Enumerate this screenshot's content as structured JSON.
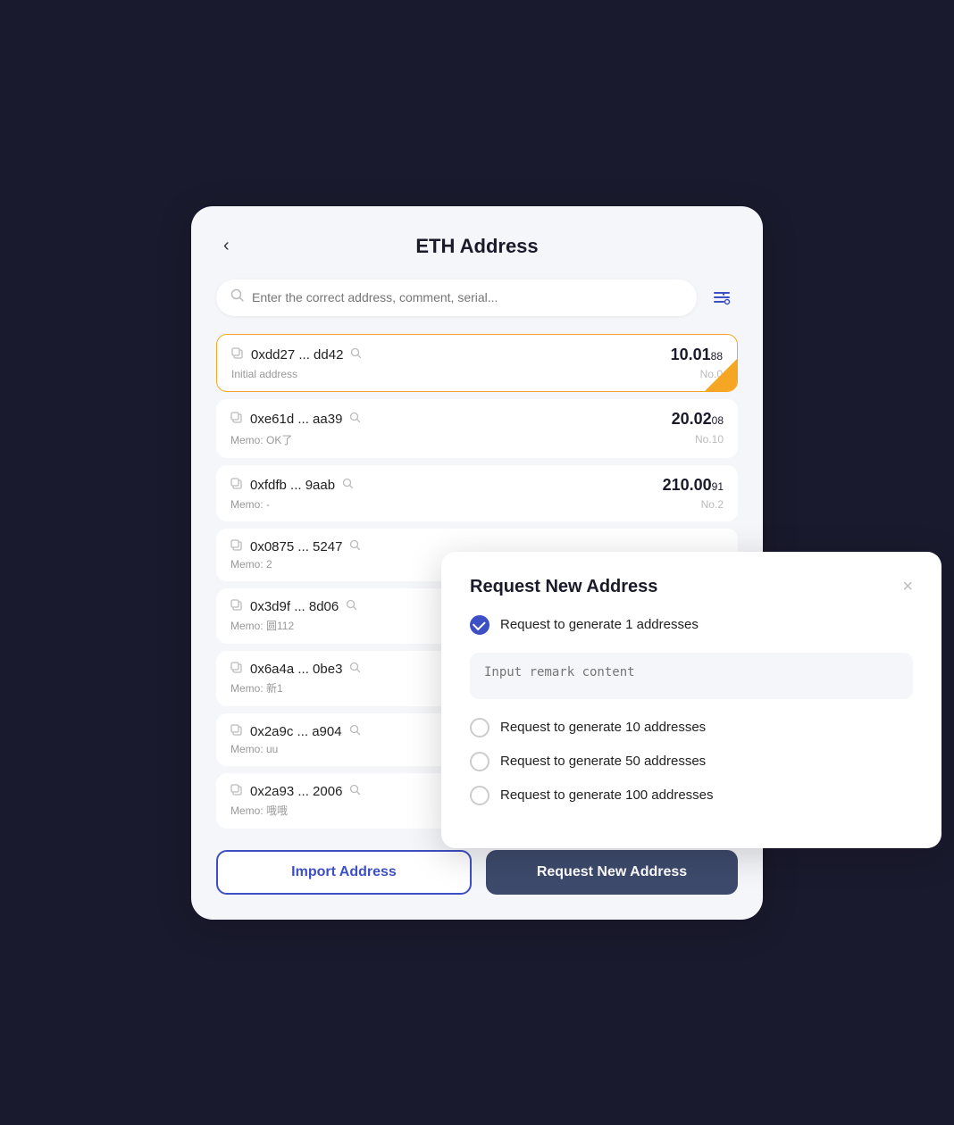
{
  "page": {
    "title": "ETH Address",
    "back_label": "‹"
  },
  "search": {
    "placeholder": "Enter the correct address, comment, serial..."
  },
  "addresses": [
    {
      "hash": "0xdd27 ... dd42",
      "memo": "Initial address",
      "balance_main": "10.01",
      "balance_decimal": "88",
      "no": "No.0",
      "selected": true
    },
    {
      "hash": "0xe61d ... aa39",
      "memo": "Memo: OK了",
      "balance_main": "20.02",
      "balance_decimal": "08",
      "no": "No.10",
      "selected": false
    },
    {
      "hash": "0xfdfb ... 9aab",
      "memo": "Memo: -",
      "balance_main": "210.00",
      "balance_decimal": "91",
      "no": "No.2",
      "selected": false
    },
    {
      "hash": "0x0875 ... 5247",
      "memo": "Memo: 2",
      "balance_main": "",
      "balance_decimal": "",
      "no": "",
      "selected": false
    },
    {
      "hash": "0x3d9f ... 8d06",
      "memo": "Memo: 圆112",
      "balance_main": "",
      "balance_decimal": "",
      "no": "",
      "selected": false
    },
    {
      "hash": "0x6a4a ... 0be3",
      "memo": "Memo: 新1",
      "balance_main": "",
      "balance_decimal": "",
      "no": "",
      "selected": false
    },
    {
      "hash": "0x2a9c ... a904",
      "memo": "Memo: uu",
      "balance_main": "",
      "balance_decimal": "",
      "no": "",
      "selected": false
    },
    {
      "hash": "0x2a93 ... 2006",
      "memo": "Memo: 哦哦",
      "balance_main": "",
      "balance_decimal": "",
      "no": "",
      "selected": false
    }
  ],
  "footer": {
    "import_label": "Import Address",
    "request_label": "Request New Address"
  },
  "modal": {
    "title": "Request New Address",
    "close_label": "×",
    "remark_placeholder": "Input remark content",
    "options": [
      {
        "label": "Request to generate 1 addresses",
        "checked": true
      },
      {
        "label": "Request to generate 10 addresses",
        "checked": false
      },
      {
        "label": "Request to generate 50 addresses",
        "checked": false
      },
      {
        "label": "Request to generate 100 addresses",
        "checked": false
      }
    ]
  }
}
